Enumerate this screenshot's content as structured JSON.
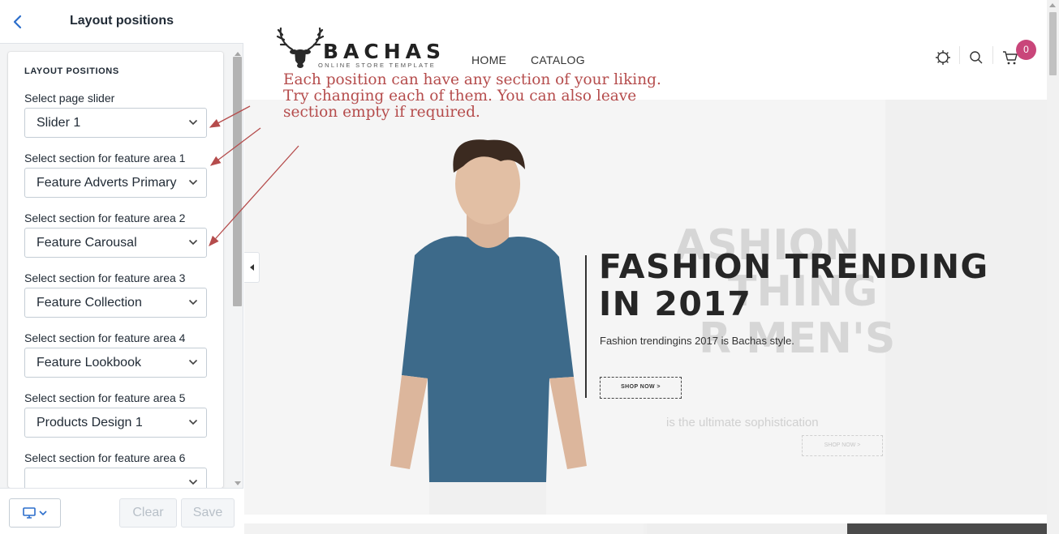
{
  "panel": {
    "title": "Layout positions",
    "section_heading": "LAYOUT POSITIONS",
    "fields": [
      {
        "label": "Select page slider",
        "value": "Slider 1"
      },
      {
        "label": "Select section for feature area 1",
        "value": "Feature Adverts Primary"
      },
      {
        "label": "Select section for feature area 2",
        "value": "Feature Carousal"
      },
      {
        "label": "Select section for feature area 3",
        "value": "Feature Collection"
      },
      {
        "label": "Select section for feature area 4",
        "value": "Feature Lookbook"
      },
      {
        "label": "Select section for feature area 5",
        "value": "Products Design 1"
      },
      {
        "label": "Select section for feature area 6",
        "value": ""
      }
    ],
    "footer": {
      "clear_label": "Clear",
      "save_label": "Save"
    }
  },
  "site": {
    "logo_text": "BACHAS",
    "logo_subtext": "ONLINE STORE TEMPLATE",
    "nav": {
      "home": "HOME",
      "catalog": "CATALOG"
    },
    "cart_count": "0",
    "annotation_lines": [
      "Each position can have any section of your liking.",
      "Try changing each of them. You can also leave",
      "section empty if required."
    ],
    "hero": {
      "title_line1": "FASHION TRENDING",
      "title_line2": "IN 2017",
      "subtitle": "Fashion trendingins 2017 is Bachas style.",
      "button": "SHOP NOW  >",
      "ghost_lines": [
        "ASHION",
        "THING",
        "R MEN'S"
      ],
      "ghost_subtitle": "is the ultimate sophistication",
      "ghost_button": "SHOP NOW  >"
    }
  },
  "colors": {
    "annotation": "#b54c4c",
    "badge": "#c9467a",
    "accent": "#2c6ecb"
  }
}
